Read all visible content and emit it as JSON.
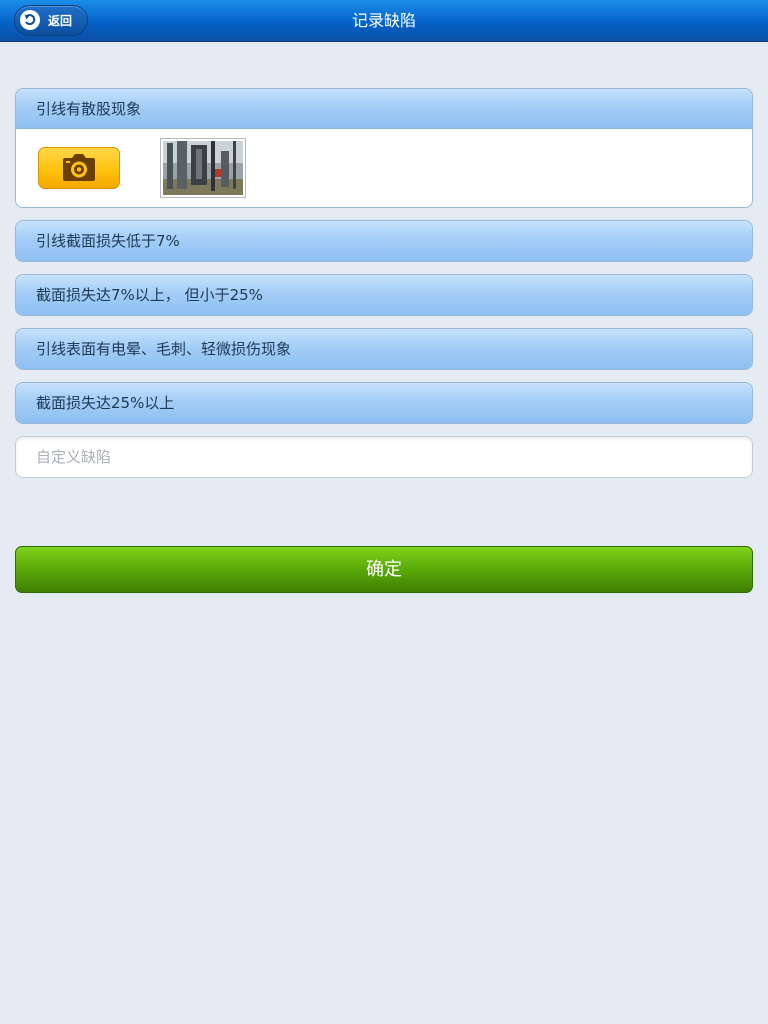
{
  "header": {
    "back_label": "返回",
    "title": "记录缺陷",
    "colors": {
      "bar_top": "#1a8ee8",
      "bar_bottom": "#0b4fa6"
    }
  },
  "defects": [
    {
      "label": "引线有散股现象",
      "expanded": true,
      "has_photo": true
    },
    {
      "label": "引线截面损失低于7%",
      "expanded": false
    },
    {
      "label": "截面损失达7%以上， 但小于25%",
      "expanded": false
    },
    {
      "label": "引线表面有电晕、毛刺、轻微损伤现象",
      "expanded": false
    },
    {
      "label": "截面损失达25%以上",
      "expanded": false
    }
  ],
  "photo_controls": {
    "camera_icon": "camera-icon",
    "thumbnail_icon": "photo-thumbnail"
  },
  "custom_defect": {
    "value": "",
    "placeholder": "自定义缺陷"
  },
  "confirm": {
    "label": "确定",
    "color": "#5aaa0a"
  },
  "colors": {
    "background": "#e4ebf2",
    "item_header": "#a4cdf6",
    "camera_button": "#ffc20e"
  }
}
